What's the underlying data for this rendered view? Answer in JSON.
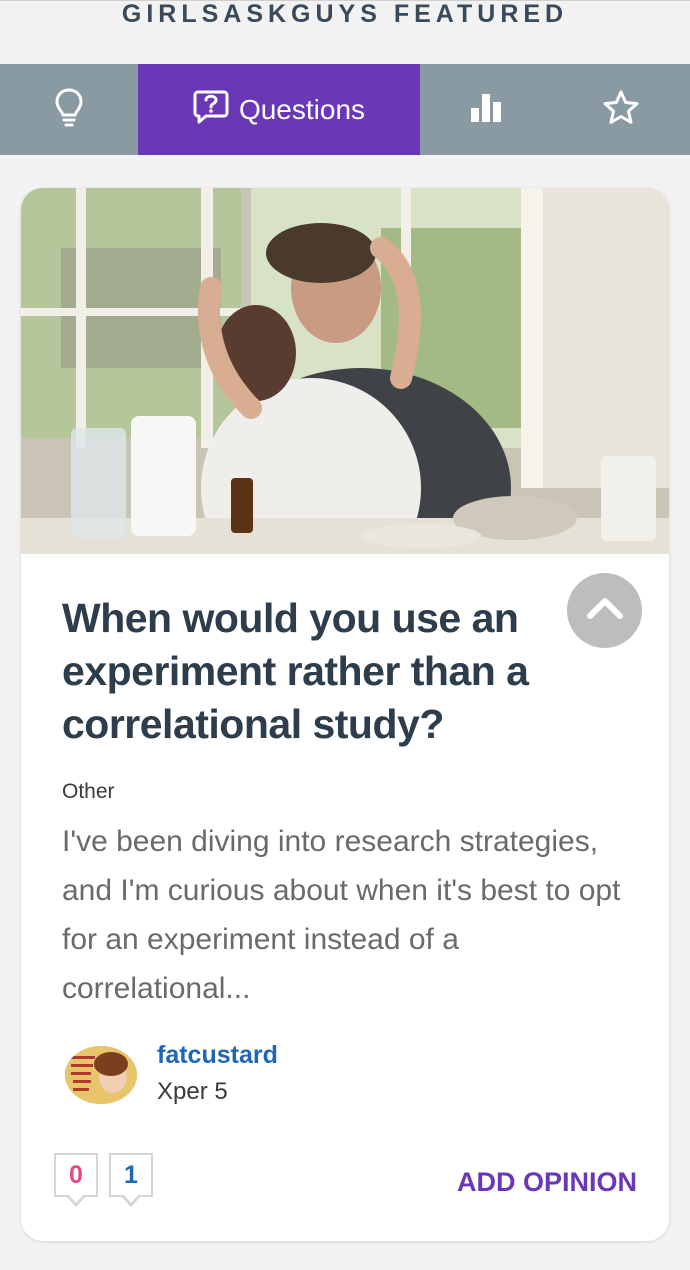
{
  "header": {
    "title": "GIRLSASKGUYS FEATURED"
  },
  "tabs": [
    {
      "icon": "lightbulb-icon",
      "label": ""
    },
    {
      "icon": "question-bubble-icon",
      "label": "Questions"
    },
    {
      "icon": "bar-chart-icon",
      "label": ""
    },
    {
      "icon": "star-icon",
      "label": ""
    }
  ],
  "colors": {
    "accent": "#6a37b7",
    "tabbar": "#8a9aa3",
    "title": "#2d3d4c",
    "link": "#1f66b6",
    "likes": "#e04a8a"
  },
  "question": {
    "title": "When would you use an experiment rather than a correlational study?",
    "category": "Other",
    "excerpt": "I've been diving into research strategies, and I'm curious about when it's best to opt for an experiment instead of a correlational..."
  },
  "author": {
    "username": "fatcustard",
    "level": "Xper 5"
  },
  "counts": {
    "likes": "0",
    "opinions": "1"
  },
  "actions": {
    "add_opinion": "ADD OPINION"
  }
}
